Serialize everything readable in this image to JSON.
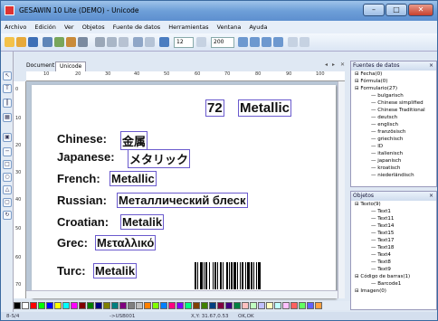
{
  "window": {
    "title": "GESAWIN 10 Lite (DEMO) - Unicode"
  },
  "menu": [
    "Archivo",
    "Edición",
    "Ver",
    "Objetos",
    "Fuente de datos",
    "Herramientas",
    "Ventana",
    "Ayuda"
  ],
  "toolbar": {
    "font_size": "12",
    "zoom": "200"
  },
  "tabs": [
    "Document1",
    "Unicode"
  ],
  "ruler_h": [
    "10",
    "20",
    "30",
    "40",
    "50",
    "60",
    "70",
    "80",
    "90",
    "100"
  ],
  "ruler_v": [
    "0",
    "10",
    "20",
    "30",
    "40",
    "50",
    "60",
    "70"
  ],
  "canvas": {
    "header_number": "72",
    "header_word": "Metallic",
    "rows": [
      {
        "label": "Chinese:",
        "value": "金属"
      },
      {
        "label": "Japanese:",
        "value": "メタリック"
      },
      {
        "label": "French:",
        "value": "Metallic"
      },
      {
        "label": "Russian:",
        "value": "Металлический блеск"
      },
      {
        "label": "Croatian:",
        "value": "Metalik"
      },
      {
        "label": "Grec:",
        "value": "Μεταλλικό"
      },
      {
        "label": "Turc:",
        "value": "Metalik"
      }
    ]
  },
  "datasources": {
    "title": "Fuentes de datos",
    "items": [
      {
        "label": "Fecha(0)",
        "level": 0
      },
      {
        "label": "Fórmula(0)",
        "level": 0
      },
      {
        "label": "Formulario(27)",
        "level": 0
      },
      {
        "label": "bulgarisch",
        "level": 1
      },
      {
        "label": "Chinese simplified",
        "level": 1
      },
      {
        "label": "Chinese Traditional",
        "level": 1
      },
      {
        "label": "deutsch",
        "level": 1
      },
      {
        "label": "englisch",
        "level": 1
      },
      {
        "label": "französisch",
        "level": 1
      },
      {
        "label": "griechisch",
        "level": 1
      },
      {
        "label": "ID",
        "level": 1
      },
      {
        "label": "italienisch",
        "level": 1
      },
      {
        "label": "japanisch",
        "level": 1
      },
      {
        "label": "kroatisch",
        "level": 1
      },
      {
        "label": "niederländisch",
        "level": 1
      }
    ]
  },
  "objects": {
    "title": "Objetos",
    "items": [
      {
        "label": "Texto(9)",
        "level": 0
      },
      {
        "label": "Text1",
        "level": 1
      },
      {
        "label": "Text11",
        "level": 1
      },
      {
        "label": "Text14",
        "level": 1
      },
      {
        "label": "Text15",
        "level": 1
      },
      {
        "label": "Text17",
        "level": 1
      },
      {
        "label": "Text18",
        "level": 1
      },
      {
        "label": "Text4",
        "level": 1
      },
      {
        "label": "Text8",
        "level": 1
      },
      {
        "label": "Text9",
        "level": 1
      },
      {
        "label": "Código de barras(1)",
        "level": 0
      },
      {
        "label": "Barcode1",
        "level": 1
      },
      {
        "label": "Imagen(0)",
        "level": 0
      }
    ]
  },
  "status": {
    "left": "8-S/4",
    "mid": "->USB001",
    "coords": "X,Y: 31.67,0.53",
    "extra": "OK,OK"
  },
  "palette": [
    "#000000",
    "#ffffff",
    "#ff0000",
    "#00ff00",
    "#0000ff",
    "#ffff00",
    "#00ffff",
    "#ff00ff",
    "#800000",
    "#008000",
    "#000080",
    "#808000",
    "#008080",
    "#800080",
    "#808080",
    "#c0c0c0",
    "#ff8000",
    "#80ff00",
    "#0080ff",
    "#ff0080",
    "#8000ff",
    "#00ff80",
    "#804000",
    "#408000",
    "#004080",
    "#800040",
    "#400080",
    "#008040",
    "#ffc0c0",
    "#c0ffc0",
    "#c0c0ff",
    "#ffffc0",
    "#c0ffff",
    "#ffc0ff",
    "#ff6060",
    "#60ff60",
    "#6060ff",
    "#ffa040"
  ]
}
